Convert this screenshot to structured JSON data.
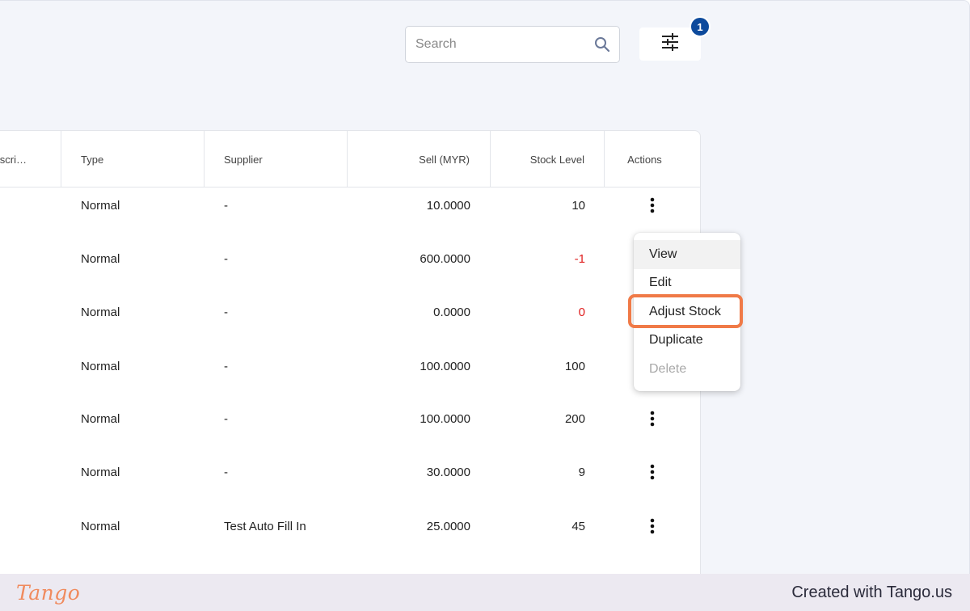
{
  "search": {
    "placeholder": "Search",
    "value": ""
  },
  "filter": {
    "badge_count": "1"
  },
  "table": {
    "columns": [
      "scri…",
      "Type",
      "Supplier",
      "Sell (MYR)",
      "Stock Level",
      "Actions"
    ],
    "rows": [
      {
        "type": "Normal",
        "supplier": "-",
        "sell": "10.0000",
        "stock": "10",
        "stock_negative": false
      },
      {
        "type": "Normal",
        "supplier": "-",
        "sell": "600.0000",
        "stock": "-1",
        "stock_negative": true
      },
      {
        "type": "Normal",
        "supplier": "-",
        "sell": "0.0000",
        "stock": "0",
        "stock_negative": true
      },
      {
        "type": "Normal",
        "supplier": "-",
        "sell": "100.0000",
        "stock": "100",
        "stock_negative": false
      },
      {
        "type": "Normal",
        "supplier": "-",
        "sell": "100.0000",
        "stock": "200",
        "stock_negative": false
      },
      {
        "type": "Normal",
        "supplier": "-",
        "sell": "30.0000",
        "stock": "9",
        "stock_negative": false
      },
      {
        "type": "Normal",
        "supplier": "Test Auto Fill In",
        "sell": "25.0000",
        "stock": "45",
        "stock_negative": false
      }
    ]
  },
  "action_menu": {
    "items": [
      {
        "label": "View",
        "state": "hover"
      },
      {
        "label": "Edit",
        "state": "normal"
      },
      {
        "label": "Adjust Stock",
        "state": "highlighted"
      },
      {
        "label": "Duplicate",
        "state": "normal"
      },
      {
        "label": "Delete",
        "state": "disabled"
      }
    ]
  },
  "footer": {
    "logo": "Tango",
    "credit": "Created with Tango.us"
  },
  "colors": {
    "badge": "#0d4a9c",
    "negative": "#e02020",
    "highlight": "#f07a47",
    "logo": "#f08a5d"
  }
}
